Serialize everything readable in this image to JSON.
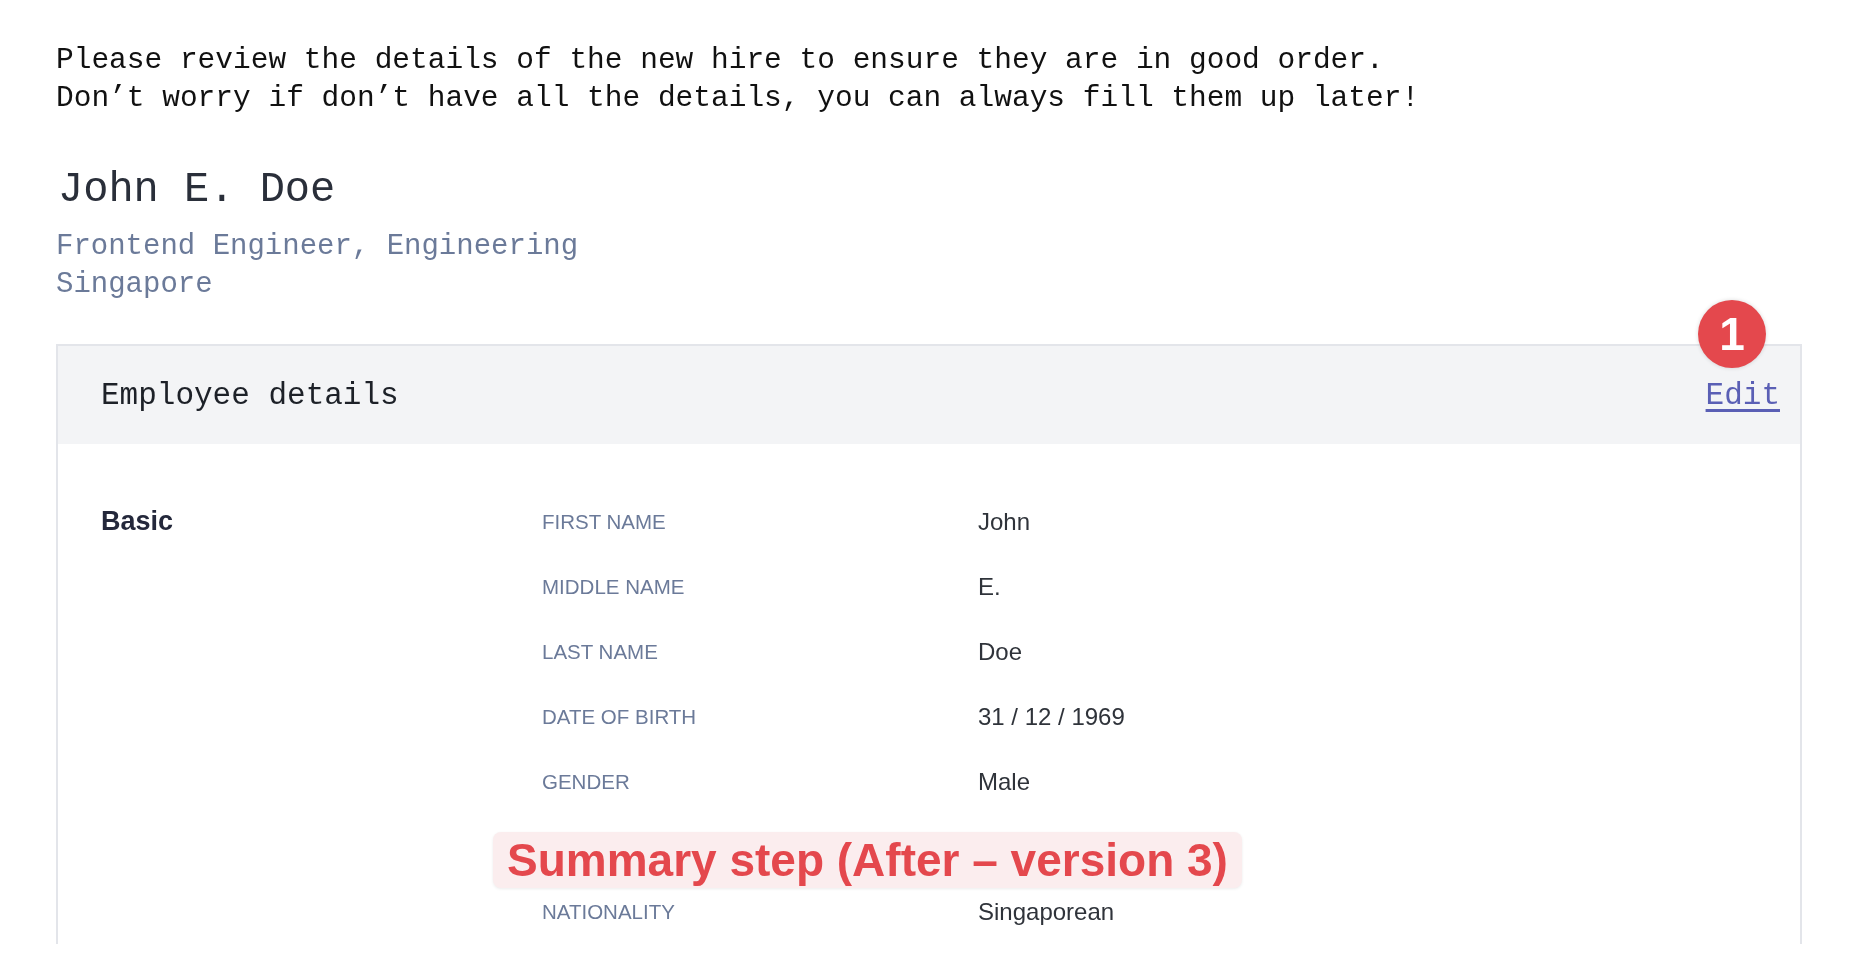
{
  "intro": [
    "Please review the details of the new hire to ensure they are in good order.",
    "Don’t worry if don’t have all the details, you can always fill them up later!"
  ],
  "employee": {
    "name": "John E. Doe",
    "role": "Frontend Engineer, Engineering",
    "location": "Singapore"
  },
  "card": {
    "title": "Employee details",
    "edit_link": "Edit",
    "step_badge": "1",
    "section": "Basic",
    "fields": [
      {
        "label": "FIRST NAME",
        "value": "John"
      },
      {
        "label": "MIDDLE NAME",
        "value": "E."
      },
      {
        "label": "LAST NAME",
        "value": "Doe"
      },
      {
        "label": "DATE OF BIRTH",
        "value": "31 / 12 / 1969"
      },
      {
        "label": "GENDER",
        "value": "Male"
      },
      {
        "kind": "caption",
        "text": "Summary step (After – version 3)"
      },
      {
        "label": "NATIONALITY",
        "value": "Singaporean"
      }
    ]
  }
}
